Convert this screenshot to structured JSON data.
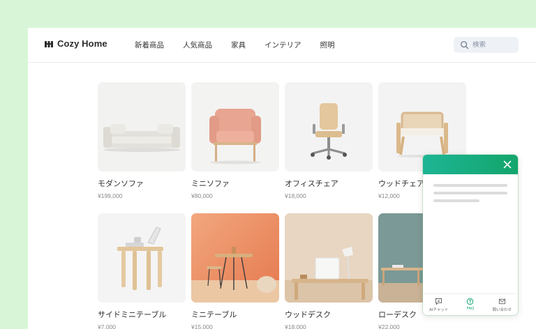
{
  "header": {
    "brand": "Cozy Home",
    "nav": [
      "新着商品",
      "人気商品",
      "家具",
      "インテリア",
      "照明"
    ],
    "search_placeholder": "検索"
  },
  "products": [
    {
      "name": "モダンソファ",
      "price": "¥199,000"
    },
    {
      "name": "ミニソファ",
      "price": "¥80,000"
    },
    {
      "name": "オフィスチェア",
      "price": "¥18,000"
    },
    {
      "name": "ウッドチェア",
      "price": "¥12,000"
    },
    {
      "name": "サイドミニテーブル",
      "price": "¥7,000"
    },
    {
      "name": "ミニテーブル",
      "price": "¥15,000"
    },
    {
      "name": "ウッドデスク",
      "price": "¥18,000"
    },
    {
      "name": "ローデスク",
      "price": "¥22,000"
    }
  ],
  "chat_widget": {
    "accent": "#17ae82",
    "tabs": [
      {
        "label": "AIチャット",
        "icon": "ai-chat-icon"
      },
      {
        "label": "FAQ",
        "icon": "question-icon"
      },
      {
        "label": "問い合わせ",
        "icon": "mail-icon"
      }
    ]
  },
  "colors": {
    "background": "#d8f5d8",
    "accent": "#17ae82"
  }
}
